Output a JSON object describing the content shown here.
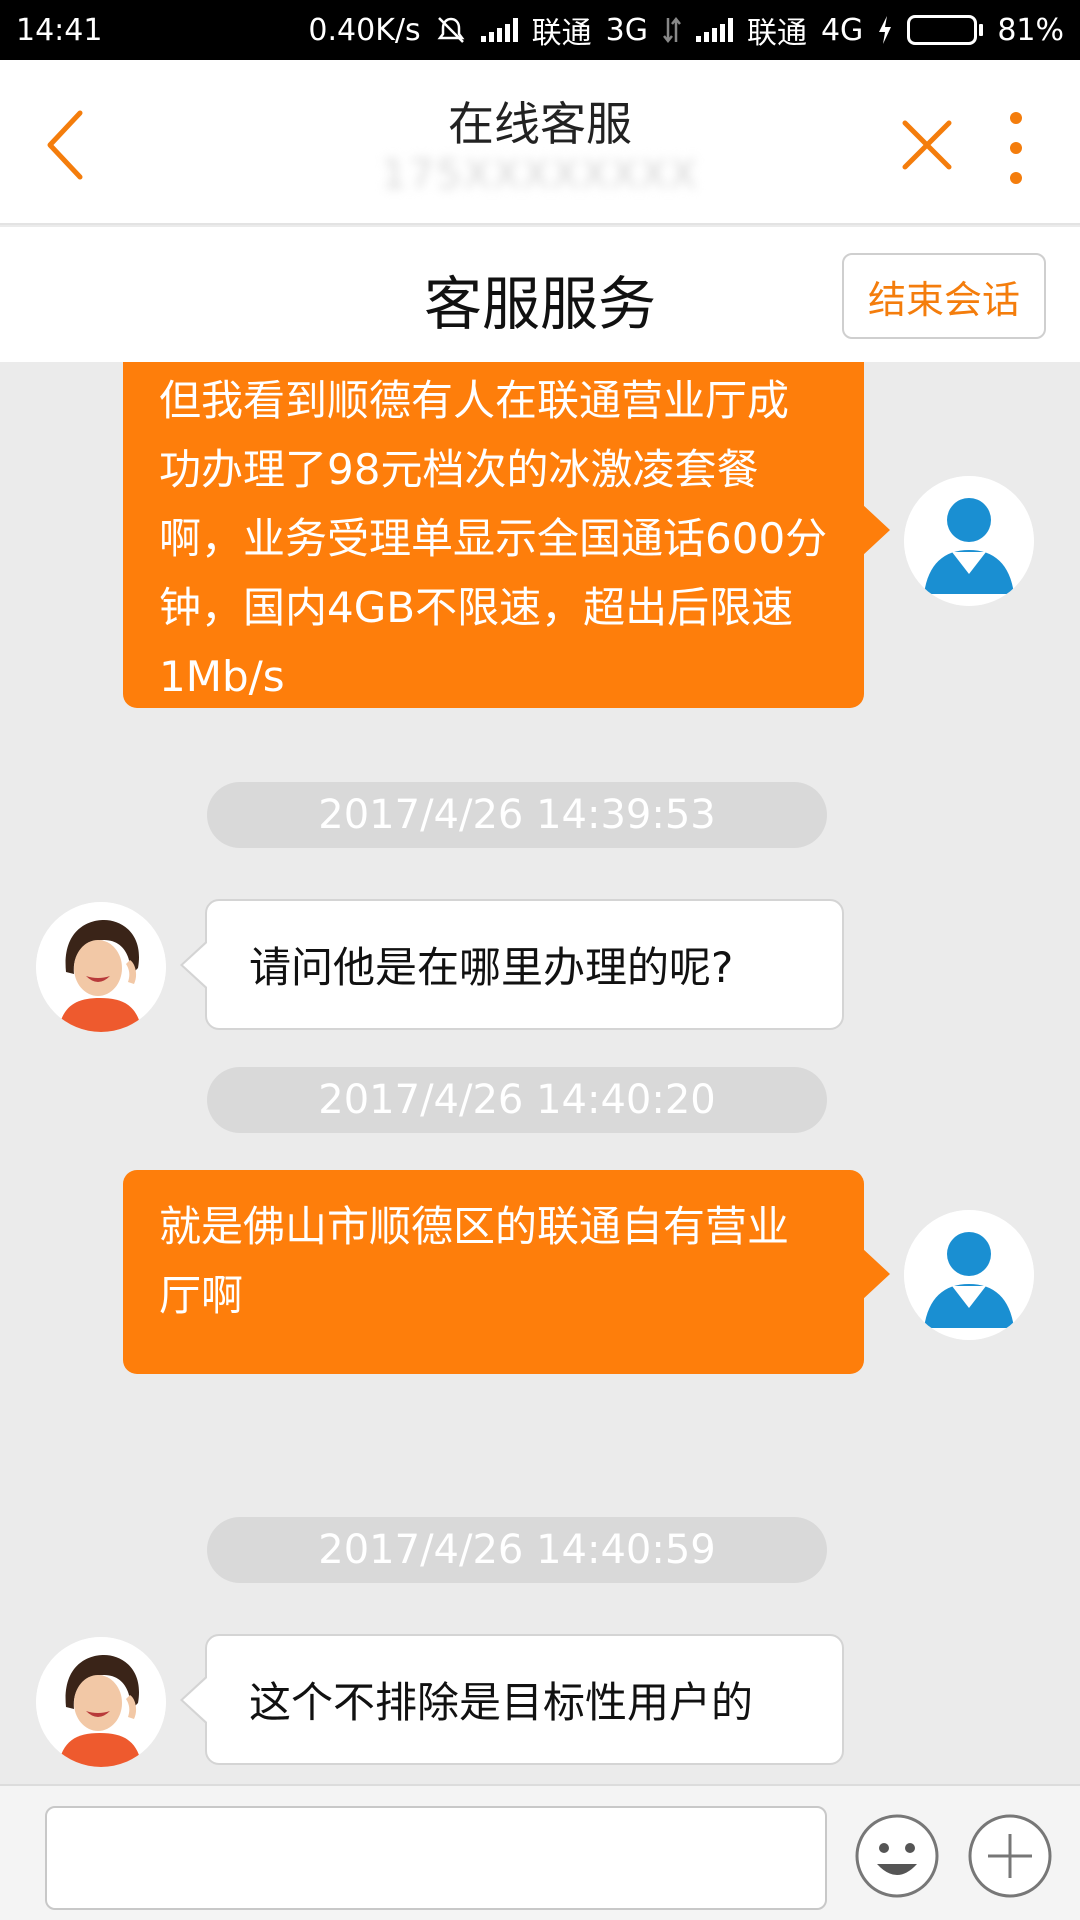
{
  "status_bar": {
    "time": "14:41",
    "net_speed": "0.40K/s",
    "carrier1": "联通",
    "network1": "3G",
    "carrier2": "联通",
    "network2": "4G",
    "battery": "81%",
    "battery_level": 0.81
  },
  "header": {
    "title": "在线客服",
    "subtitle": "175XXXXXXXX",
    "back_icon": "chevron-left-icon",
    "close_icon": "close-icon",
    "more_icon": "more-vertical-icon"
  },
  "service_bar": {
    "title": "客服服务",
    "end_button": "结束会话"
  },
  "messages": [
    {
      "from": "user",
      "text": "但我看到顺德有人在联通营业厅成功办理了98元档次的冰激凌套餐啊，业务受理单显示全国通话600分钟，国内4GB不限速，超出后限速1Mb/s"
    },
    {
      "timestamp": "2017/4/26 14:39:53"
    },
    {
      "from": "agent",
      "text": "请问他是在哪里办理的呢?"
    },
    {
      "timestamp": "2017/4/26 14:40:20"
    },
    {
      "from": "user",
      "text": "就是佛山市顺德区的联通自有营业厅啊"
    },
    {
      "timestamp": "2017/4/26 14:40:59"
    },
    {
      "from": "agent",
      "text": "这个不排除是目标性用户的"
    }
  ],
  "input_bar": {
    "placeholder": "",
    "emoji_icon": "emoji-icon",
    "plus_icon": "plus-icon"
  },
  "colors": {
    "accent": "#fe7e0b",
    "user_avatar": "#1a8fd2",
    "timestamp_bg": "#d9d9d9"
  }
}
